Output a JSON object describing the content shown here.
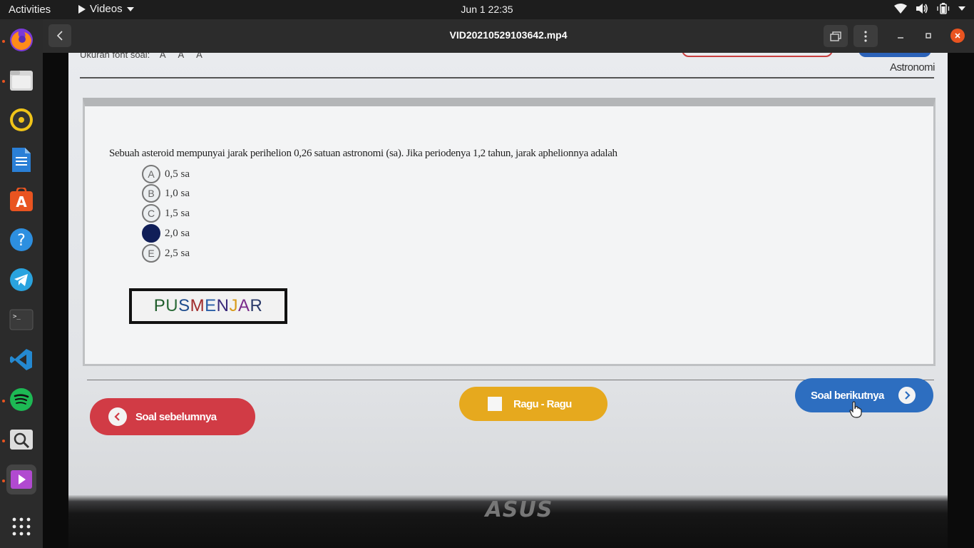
{
  "topbar": {
    "activities": "Activities",
    "app_name": "Videos",
    "clock": "Jun 1  22:35"
  },
  "window": {
    "title": "VID20210529103642.mp4"
  },
  "dock": {
    "items": [
      "firefox-icon",
      "files-icon",
      "rhythmbox-icon",
      "writer-icon",
      "software-icon",
      "help-icon",
      "telegram-icon",
      "terminal-icon",
      "vscode-icon",
      "spotify-icon",
      "search-icon",
      "videos-icon",
      "apps-grid-icon"
    ]
  },
  "exam": {
    "font_size_label": "Ukuran font soal:",
    "font_sizes": [
      "A",
      "A",
      "A"
    ],
    "topic": "Astronomi",
    "question": "Sebuah asteroid mempunyai jarak perihelion 0,26 satuan astronomi (sa). Jika periodenya 1,2 tahun, jarak aphelionnya adalah",
    "options": [
      {
        "letter": "A",
        "text": "0,5 sa"
      },
      {
        "letter": "B",
        "text": "1,0 sa"
      },
      {
        "letter": "C",
        "text": "1,5 sa"
      },
      {
        "letter": "D",
        "text": "2,0 sa"
      },
      {
        "letter": "E",
        "text": "2,5 sa"
      }
    ],
    "selected_option": "D",
    "logo_text": "PUSMENJAR",
    "prev_label": "Soal sebelumnya",
    "doubt_label": "Ragu - Ragu",
    "next_label": "Soal berikutnya"
  },
  "monitor_brand": "ASUS",
  "colors": {
    "selected_option": "#101e58",
    "prev_button": "#d13b45",
    "doubt_button": "#e6a91e",
    "next_button": "#2d6ec0",
    "close_button": "#e95420"
  }
}
